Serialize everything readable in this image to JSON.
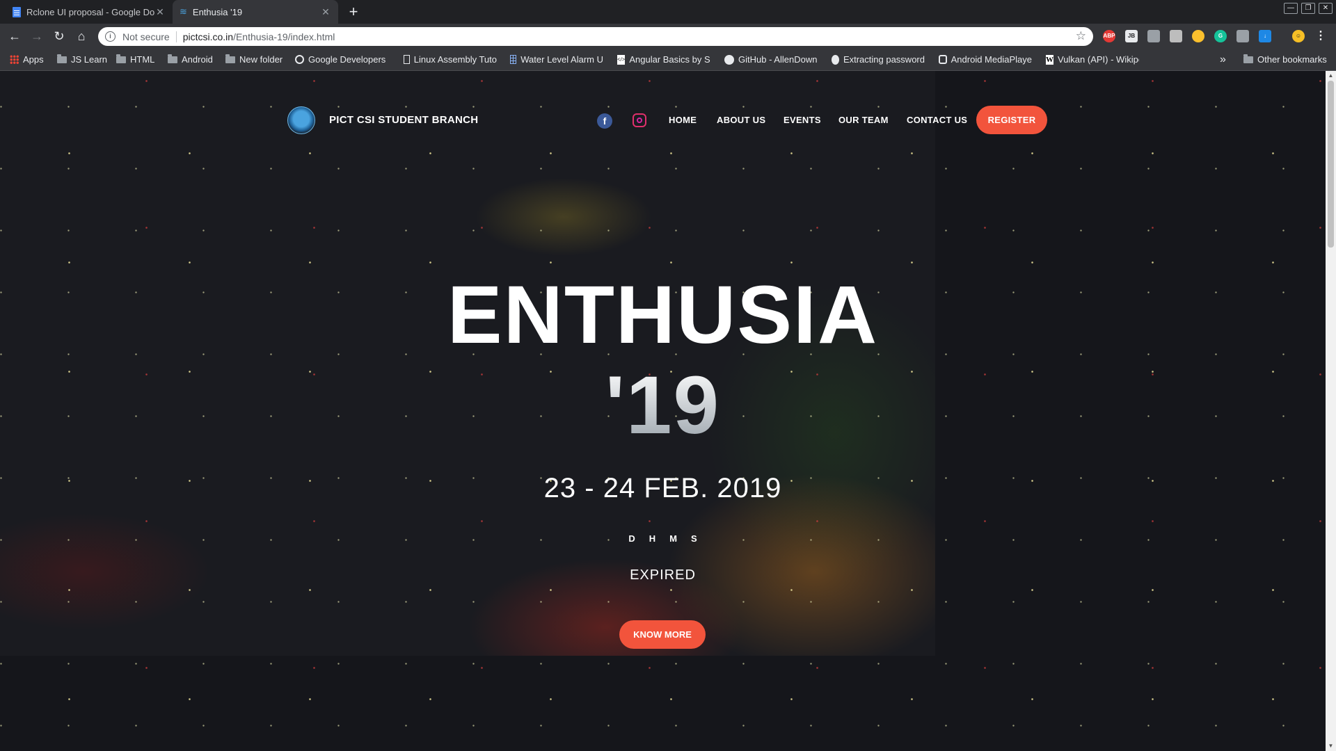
{
  "browser": {
    "tabs": [
      {
        "title": "Rclone UI proposal - Google Do",
        "icon": "google-docs-icon",
        "active": false
      },
      {
        "title": "Enthusia '19",
        "icon": "site-favicon",
        "active": true
      }
    ],
    "new_tab": "+",
    "window_controls": [
      "—",
      "❐",
      "✕"
    ],
    "address": {
      "security": "Not secure",
      "host": "pictcsi.co.in",
      "path": "/Enthusia-19/index.html"
    },
    "bookmarks": [
      {
        "label": "Apps",
        "icon": "apps-icon"
      },
      {
        "label": "JS Learn",
        "icon": "folder-icon"
      },
      {
        "label": "HTML",
        "icon": "folder-icon"
      },
      {
        "label": "Android",
        "icon": "folder-icon"
      },
      {
        "label": "New folder",
        "icon": "folder-icon"
      },
      {
        "label": "Google Developers",
        "icon": "google-icon"
      },
      {
        "label": "Linux Assembly Tuto",
        "icon": "file-icon"
      },
      {
        "label": "Water Level Alarm U",
        "icon": "grid-icon"
      },
      {
        "label": "Angular Basics by Sc",
        "icon": "page-icon"
      },
      {
        "label": "GitHub - AllenDown",
        "icon": "github-icon"
      },
      {
        "label": "Extracting password",
        "icon": "github-icon"
      },
      {
        "label": "Android MediaPlaye",
        "icon": "android-icon"
      },
      {
        "label": "Vulkan (API) - Wikipe",
        "icon": "wikipedia-icon"
      }
    ],
    "bookmarks_overflow": "»",
    "other_bookmarks": "Other bookmarks"
  },
  "site": {
    "brand": "PICT CSI STUDENT BRANCH",
    "nav": [
      "HOME",
      "ABOUT US",
      "EVENTS",
      "OUR TEAM",
      "CONTACT US"
    ],
    "register": "REGISTER",
    "title_line1": "ENTHUSIA",
    "title_line2": "'19",
    "date": "23 - 24 FEB. 2019",
    "countdown": [
      "D",
      "H",
      "M",
      "S"
    ],
    "status": "EXPIRED",
    "cta": "KNOW MORE",
    "accent_color": "#f2543c"
  }
}
